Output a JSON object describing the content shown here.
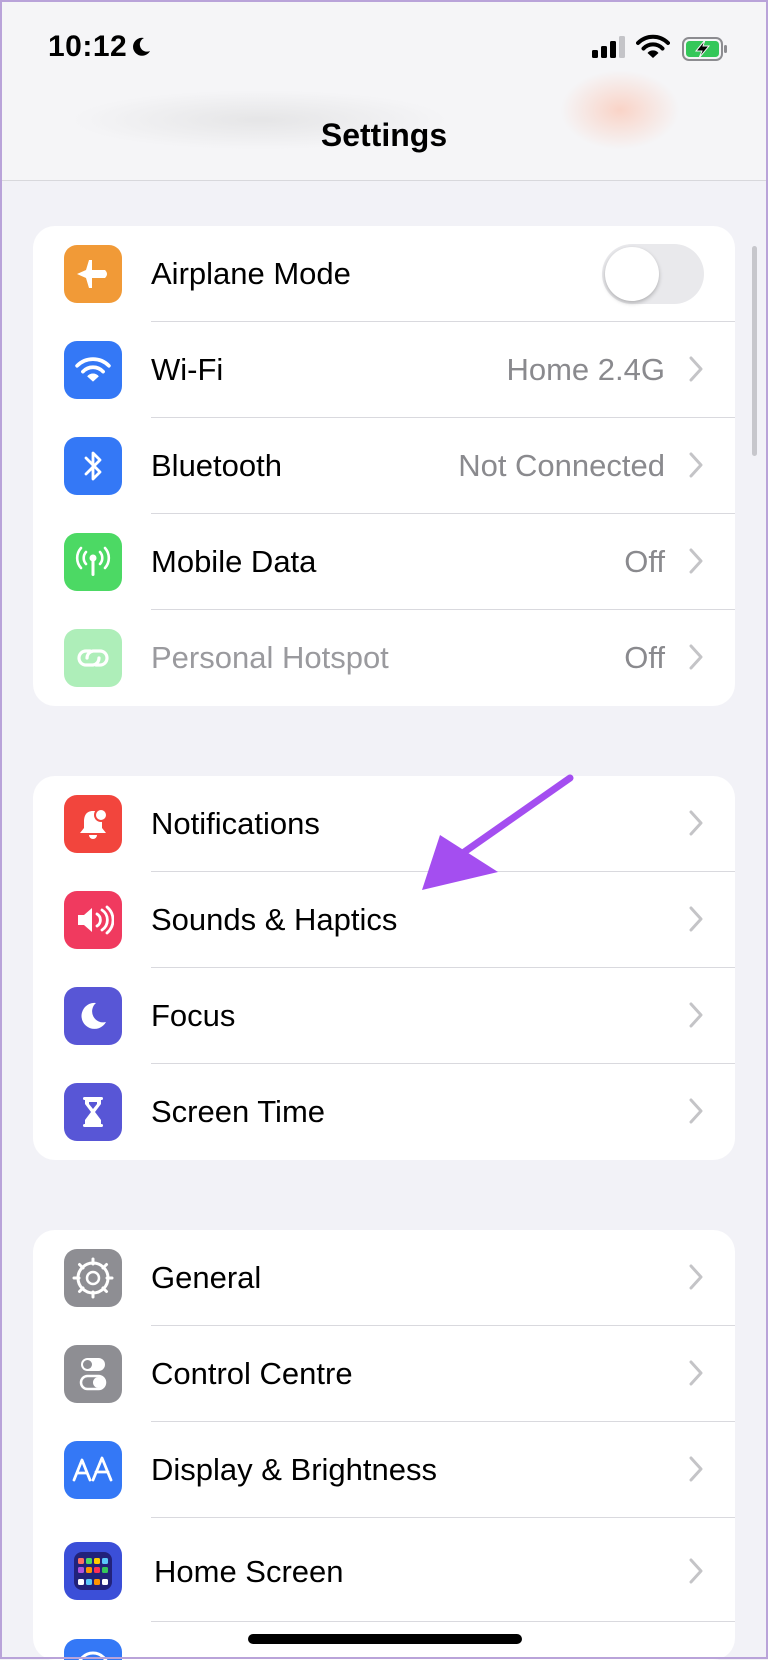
{
  "status_bar": {
    "time": "10:12"
  },
  "nav": {
    "title": "Settings"
  },
  "groups": [
    {
      "items": [
        {
          "label": "Airplane Mode",
          "icon": "airplane-icon",
          "color": "#f19a37",
          "control": "toggle",
          "toggle_on": false
        },
        {
          "label": "Wi-Fi",
          "value": "Home 2.4G",
          "icon": "wifi-icon",
          "color": "#3478f6"
        },
        {
          "label": "Bluetooth",
          "value": "Not Connected",
          "icon": "bluetooth-icon",
          "color": "#3478f6"
        },
        {
          "label": "Mobile Data",
          "value": "Off",
          "icon": "antenna-icon",
          "color": "#4cd964"
        },
        {
          "label": "Personal Hotspot",
          "value": "Off",
          "icon": "hotspot-icon",
          "color": "#4cd964",
          "disabled": true
        }
      ]
    },
    {
      "items": [
        {
          "label": "Notifications",
          "icon": "bell-icon",
          "color": "#f2453d"
        },
        {
          "label": "Sounds & Haptics",
          "icon": "speaker-icon",
          "color": "#f03a5f"
        },
        {
          "label": "Focus",
          "icon": "moon-icon",
          "color": "#5856d6"
        },
        {
          "label": "Screen Time",
          "icon": "hourglass-icon",
          "color": "#5856d6"
        }
      ]
    },
    {
      "items": [
        {
          "label": "General",
          "icon": "gear-icon",
          "color": "#8e8e93"
        },
        {
          "label": "Control Centre",
          "icon": "switches-icon",
          "color": "#8e8e93"
        },
        {
          "label": "Display & Brightness",
          "icon": "text-size-icon",
          "color": "#3478f6"
        },
        {
          "label": "Home Screen",
          "icon": "app-grid-icon",
          "color": "#3b4fd8"
        }
      ]
    }
  ],
  "annotation": {
    "arrow_color": "#a44ef0",
    "points_to": "Sounds & Haptics"
  }
}
